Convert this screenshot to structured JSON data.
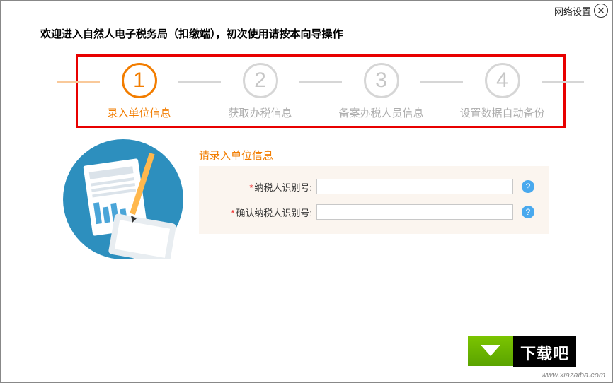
{
  "topbar": {
    "network_label": "网络设置",
    "close_glyph": "✕"
  },
  "welcome": "欢迎进入自然人电子税务局（扣缴端），初次使用请按本向导操作",
  "steps": [
    {
      "num": "1",
      "label": "录入单位信息"
    },
    {
      "num": "2",
      "label": "获取办税信息"
    },
    {
      "num": "3",
      "label": "备案办税人员信息"
    },
    {
      "num": "4",
      "label": "设置数据自动备份"
    }
  ],
  "form": {
    "title": "请录入单位信息",
    "taxpayer_label": "纳税人识别号:",
    "confirm_taxpayer_label": "确认纳税人识别号:",
    "taxpayer_value": "",
    "confirm_taxpayer_value": "",
    "required_marker": "*",
    "help_glyph": "?"
  },
  "watermark": {
    "brand": "下载吧",
    "url": "www.xiazaiba.com"
  }
}
